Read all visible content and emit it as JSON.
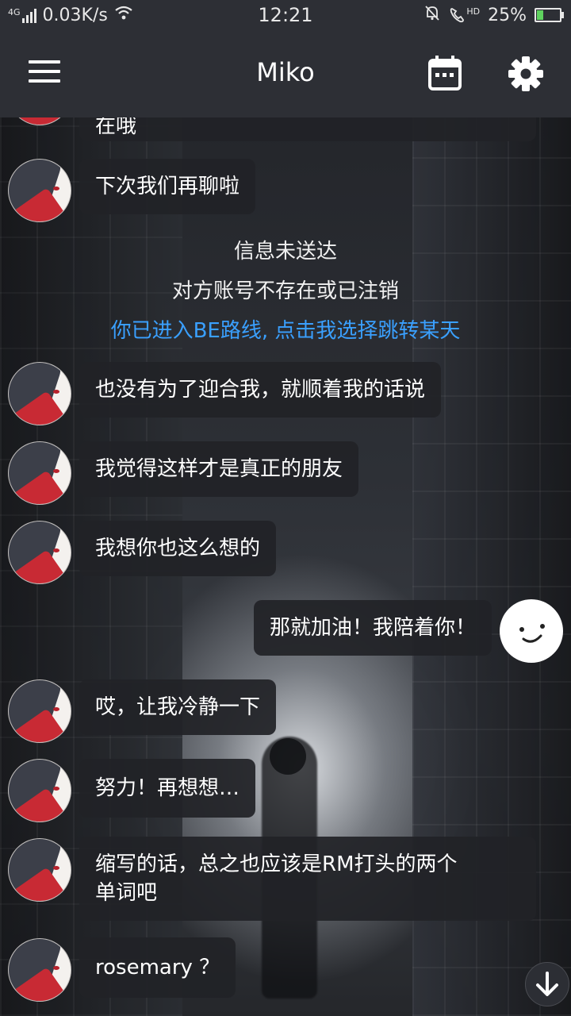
{
  "status_bar": {
    "network": "4G",
    "speed": "0.03K/s",
    "time": "12:21",
    "hd": "HD",
    "battery": "25%",
    "battery_level": 0.25,
    "icons": [
      "signal-icon",
      "wifi-icon",
      "mute-icon",
      "hd-call-icon",
      "battery-icon"
    ]
  },
  "app_bar": {
    "title": "Miko",
    "icons": [
      "menu-icon",
      "calendar-icon",
      "gear-icon"
    ]
  },
  "chat": {
    "partial_top": "在哦",
    "messages": [
      {
        "from": "miko",
        "text": "下次我们再聊啦"
      },
      {
        "from": "system",
        "text": "信息未送达"
      },
      {
        "from": "system",
        "text": "对方账号不存在或已注销"
      },
      {
        "from": "system_link",
        "text": "你已进入BE路线, 点击我选择跳转某天"
      },
      {
        "from": "miko",
        "text": "也没有为了迎合我，就顺着我的话说"
      },
      {
        "from": "miko",
        "text": "我觉得这样才是真正的朋友"
      },
      {
        "from": "miko",
        "text": "我想你也这么想的"
      },
      {
        "from": "me",
        "text": "那就加油！我陪着你！"
      },
      {
        "from": "miko",
        "text": "哎，让我冷静一下"
      },
      {
        "from": "miko",
        "text": "努力！再想想…"
      },
      {
        "from": "miko",
        "text_line1": "缩写的话，总之也应该是RM打头的两个",
        "text_line2": "单词吧"
      },
      {
        "from": "miko",
        "text": "rosemary ？"
      }
    ]
  },
  "scroll_button": {
    "icon": "arrow-down-icon"
  },
  "colors": {
    "bar": "#2d2f35",
    "bubble": "#212227",
    "link": "#3aa0ff",
    "battery": "#5fd35f"
  }
}
